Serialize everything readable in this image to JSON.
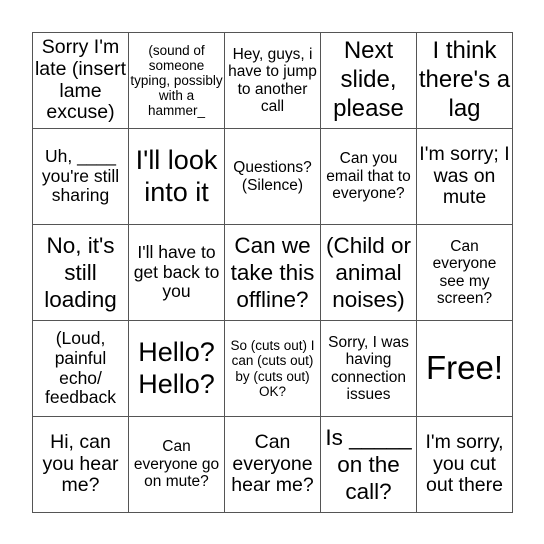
{
  "board": {
    "cells": [
      [
        "Sorry I'm late (insert lame excuse)",
        "(sound of someone typing, possibly with a hammer_",
        "Hey, guys, i have to jump to another call",
        "Next slide, please",
        "I think there's a lag"
      ],
      [
        "Uh, ____ you're still sharing",
        "I'll look into it",
        "Questions? (Silence)",
        "Can you email that to everyone?",
        "I'm sorry; I was on mute"
      ],
      [
        "No, it's still loading",
        "I'll have to get back to you",
        "Can we take this offline?",
        "(Child or animal noises)",
        "Can everyone see my screen?"
      ],
      [
        "(Loud, painful echo/ feedback",
        "Hello? Hello?",
        "So (cuts out) I can (cuts out) by (cuts out) OK?",
        "Sorry, I was having connection issues",
        "Free!"
      ],
      [
        "Hi, can you hear me?",
        "Can everyone go on mute?",
        "Can everyone hear me?",
        "Is _____ on the call?",
        "I'm sorry, you cut out there"
      ]
    ],
    "free_space": "Free!"
  }
}
